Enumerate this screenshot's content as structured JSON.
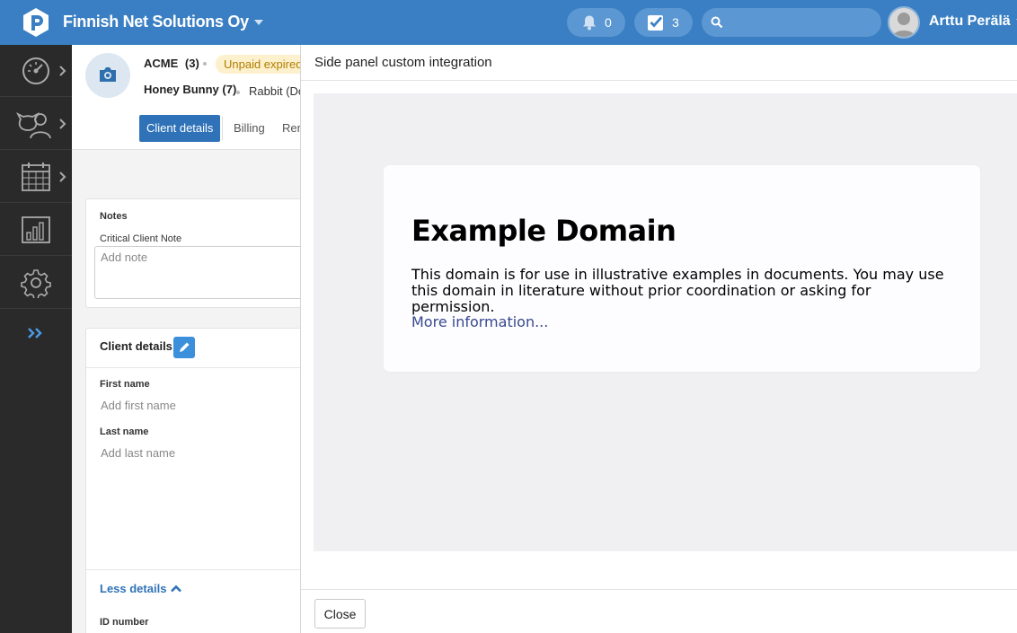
{
  "topbar": {
    "org_name": "Finnish Net Solutions Oy",
    "notifications_count": "0",
    "tasks_count": "3",
    "search_placeholder": "",
    "user_name": "Arttu Perälä"
  },
  "client": {
    "owner_name": "ACME",
    "owner_count": "(3)",
    "status_badge": "Unpaid expired",
    "pet_name": "Honey Bunny (7)",
    "pet_species": "Rabbit (Do",
    "tabs": [
      {
        "label": "Client details",
        "active": true
      },
      {
        "label": "Billing"
      },
      {
        "label": "Rem"
      }
    ],
    "notes": {
      "heading": "Notes",
      "critical_label": "Critical Client Note",
      "note_placeholder": "Add note"
    },
    "details": {
      "heading": "Client details",
      "first_name_label": "First name",
      "first_name_placeholder": "Add first name",
      "last_name_label": "Last name",
      "last_name_placeholder": "Add last name",
      "less_details": "Less details",
      "id_number_label": "ID number"
    }
  },
  "panel": {
    "title": "Side panel custom integration",
    "content": {
      "heading": "Example Domain",
      "body": "This domain is for use in illustrative examples in documents. You may use this domain in literature without prior coordination or asking for permission.",
      "link": "More information..."
    },
    "close_label": "Close"
  },
  "colors": {
    "topbar": "#3a7fc3",
    "sidebar": "#2a2a2a",
    "accent": "#2f72b8",
    "badge_bg": "#fdf0cc"
  },
  "icons": {
    "sidebar": [
      "dashboard-gauge-icon",
      "clients-pets-icon",
      "calendar-icon",
      "reports-chart-icon",
      "settings-gear-icon"
    ],
    "expand": "double-chevron-right-icon"
  }
}
